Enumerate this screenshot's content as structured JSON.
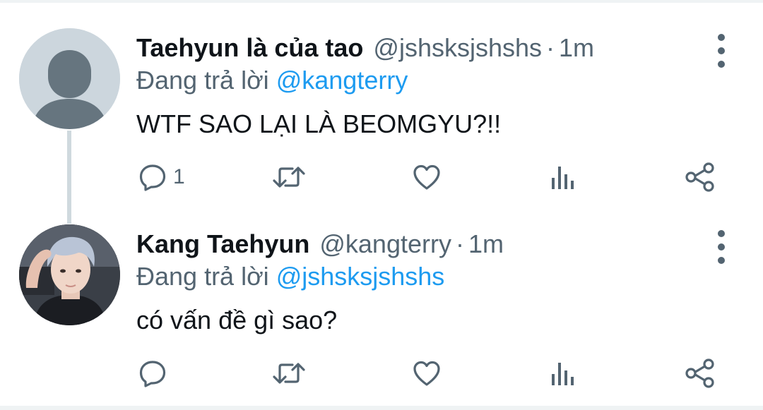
{
  "theme": {
    "text_color": "#0f1419",
    "secondary_color": "#536471",
    "link_color": "#1d9bf0",
    "thread_line_color": "#cfd9de",
    "default_avatar_bg": "#ccd6dd"
  },
  "tweets": [
    {
      "display_name": "Taehyun là của tao",
      "handle": "@jshsksjshshs",
      "separator": "·",
      "time": "1m",
      "replying_prefix": "Đang trả lời",
      "replying_to": "@kangterry",
      "text": "WTF SAO LẠI LÀ BEOMGYU?!!",
      "avatar": "default-profile-avatar",
      "reply_count": "1",
      "icons": [
        "reply-icon",
        "retweet-icon",
        "like-icon",
        "analytics-icon",
        "share-icon",
        "more-icon"
      ]
    },
    {
      "display_name": "Kang Taehyun",
      "handle": "@kangterry",
      "separator": "·",
      "time": "1m",
      "replying_prefix": "Đang trả lời",
      "replying_to": "@jshsksjshshs",
      "text": "có vấn đề gì sao?",
      "avatar": "user-photo-avatar",
      "reply_count": "",
      "icons": [
        "reply-icon",
        "retweet-icon",
        "like-icon",
        "analytics-icon",
        "share-icon",
        "more-icon"
      ]
    }
  ]
}
